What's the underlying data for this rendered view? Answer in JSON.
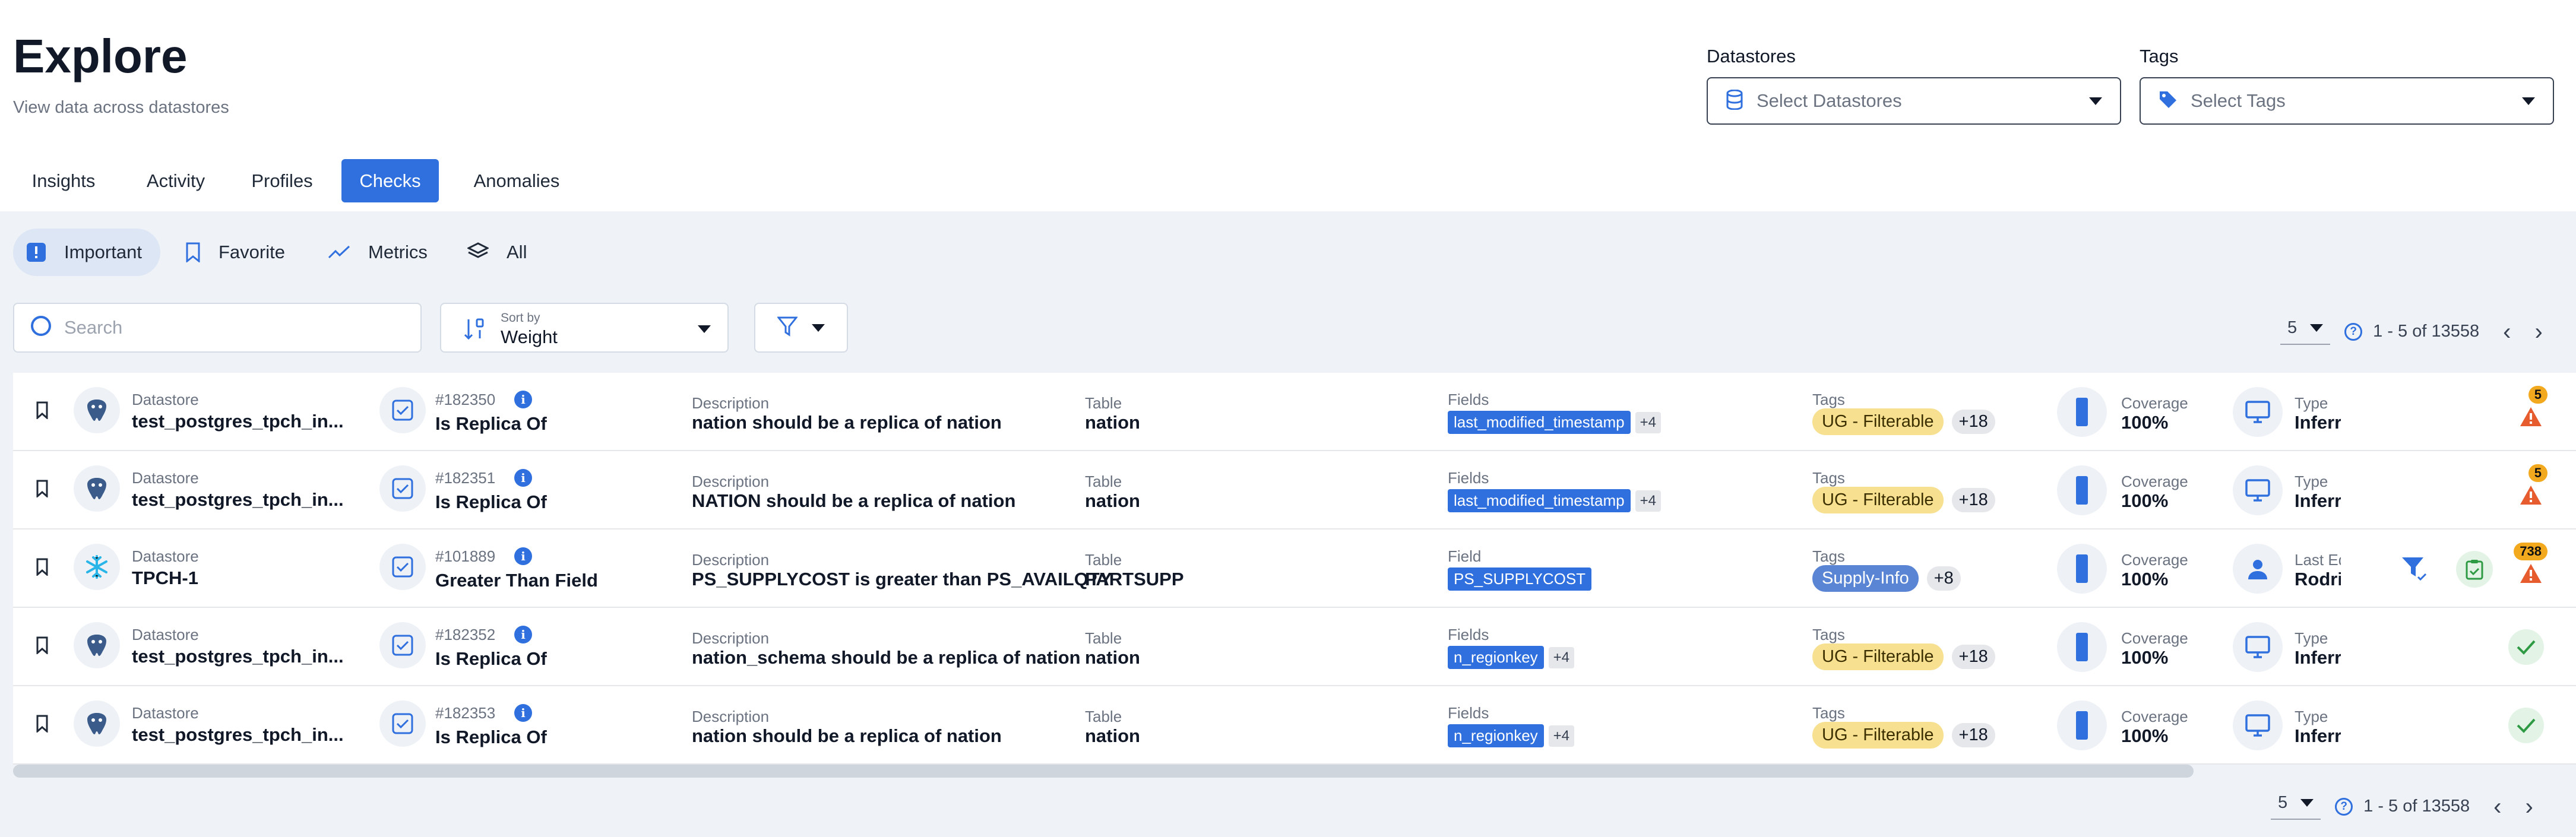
{
  "header": {
    "title": "Explore",
    "subtitle": "View data across datastores"
  },
  "filters": {
    "datastores": {
      "label": "Datastores",
      "placeholder": "Select Datastores"
    },
    "tags": {
      "label": "Tags",
      "placeholder": "Select Tags"
    }
  },
  "tabs": [
    "Insights",
    "Activity",
    "Profiles",
    "Checks",
    "Anomalies"
  ],
  "active_tab": "Checks",
  "subtabs": [
    "Important",
    "Favorite",
    "Metrics",
    "All"
  ],
  "active_subtab": "Important",
  "search": {
    "placeholder": "Search"
  },
  "sort": {
    "label": "Sort by",
    "value": "Weight"
  },
  "pager": {
    "page_size": "5",
    "range": "1 - 5 of 13558"
  },
  "colors": {
    "accent": "#2f6fde",
    "warning": "#e65c2e",
    "success": "#2e9a44",
    "tag_yellow": "#f7e08f"
  },
  "rows": [
    {
      "datastore_cap": "Datastore",
      "datastore": "test_postgres_tpch_in...",
      "datastore_icon": "postgres-icon",
      "id": "#182350",
      "rule": "Is Replica Of",
      "desc_cap": "Description",
      "desc": "nation should be a replica of nation",
      "table_cap": "Table",
      "table": "nation",
      "fields_cap": "Fields",
      "field": "last_modified_timestamp",
      "field_more": "+4",
      "tags_cap": "Tags",
      "tag": "UG - Filterable",
      "tag_more": "+18",
      "coverage_cap": "Coverage",
      "coverage": "100%",
      "type_cap": "Type",
      "type": "Inferre",
      "status": "warning",
      "anomaly_count": "5"
    },
    {
      "datastore_cap": "Datastore",
      "datastore": "test_postgres_tpch_in...",
      "datastore_icon": "postgres-icon",
      "id": "#182351",
      "rule": "Is Replica Of",
      "desc_cap": "Description",
      "desc": "NATION should be a replica of nation",
      "table_cap": "Table",
      "table": "nation",
      "fields_cap": "Fields",
      "field": "last_modified_timestamp",
      "field_more": "+4",
      "tags_cap": "Tags",
      "tag": "UG - Filterable",
      "tag_more": "+18",
      "coverage_cap": "Coverage",
      "coverage": "100%",
      "type_cap": "Type",
      "type": "Inferre",
      "status": "warning",
      "anomaly_count": "5"
    },
    {
      "datastore_cap": "Datastore",
      "datastore": "TPCH-1",
      "datastore_icon": "snowflake-icon",
      "id": "#101889",
      "rule": "Greater Than Field",
      "desc_cap": "Description",
      "desc": "PS_SUPPLYCOST is greater than PS_AVAILQTY",
      "table_cap": "Table",
      "table": "PARTSUPP",
      "fields_cap": "Field",
      "field": "PS_SUPPLYCOST",
      "field_more": "",
      "tags_cap": "Tags",
      "tag": "Supply-Info",
      "tag_more": "+8",
      "coverage_cap": "Coverage",
      "coverage": "100%",
      "type_cap": "Last Edit",
      "type": "Rodrig",
      "status": "warning",
      "anomaly_count": "738"
    },
    {
      "datastore_cap": "Datastore",
      "datastore": "test_postgres_tpch_in...",
      "datastore_icon": "postgres-icon",
      "id": "#182352",
      "rule": "Is Replica Of",
      "desc_cap": "Description",
      "desc": "nation_schema should be a replica of nation",
      "table_cap": "Table",
      "table": "nation",
      "fields_cap": "Fields",
      "field": "n_regionkey",
      "field_more": "+4",
      "tags_cap": "Tags",
      "tag": "UG - Filterable",
      "tag_more": "+18",
      "coverage_cap": "Coverage",
      "coverage": "100%",
      "type_cap": "Type",
      "type": "Inferre",
      "status": "ok",
      "anomaly_count": ""
    },
    {
      "datastore_cap": "Datastore",
      "datastore": "test_postgres_tpch_in...",
      "datastore_icon": "postgres-icon",
      "id": "#182353",
      "rule": "Is Replica Of",
      "desc_cap": "Description",
      "desc": "nation should be a replica of nation",
      "table_cap": "Table",
      "table": "nation",
      "fields_cap": "Fields",
      "field": "n_regionkey",
      "field_more": "+4",
      "tags_cap": "Tags",
      "tag": "UG - Filterable",
      "tag_more": "+18",
      "coverage_cap": "Coverage",
      "coverage": "100%",
      "type_cap": "Type",
      "type": "Inferre",
      "status": "ok",
      "anomaly_count": ""
    }
  ]
}
